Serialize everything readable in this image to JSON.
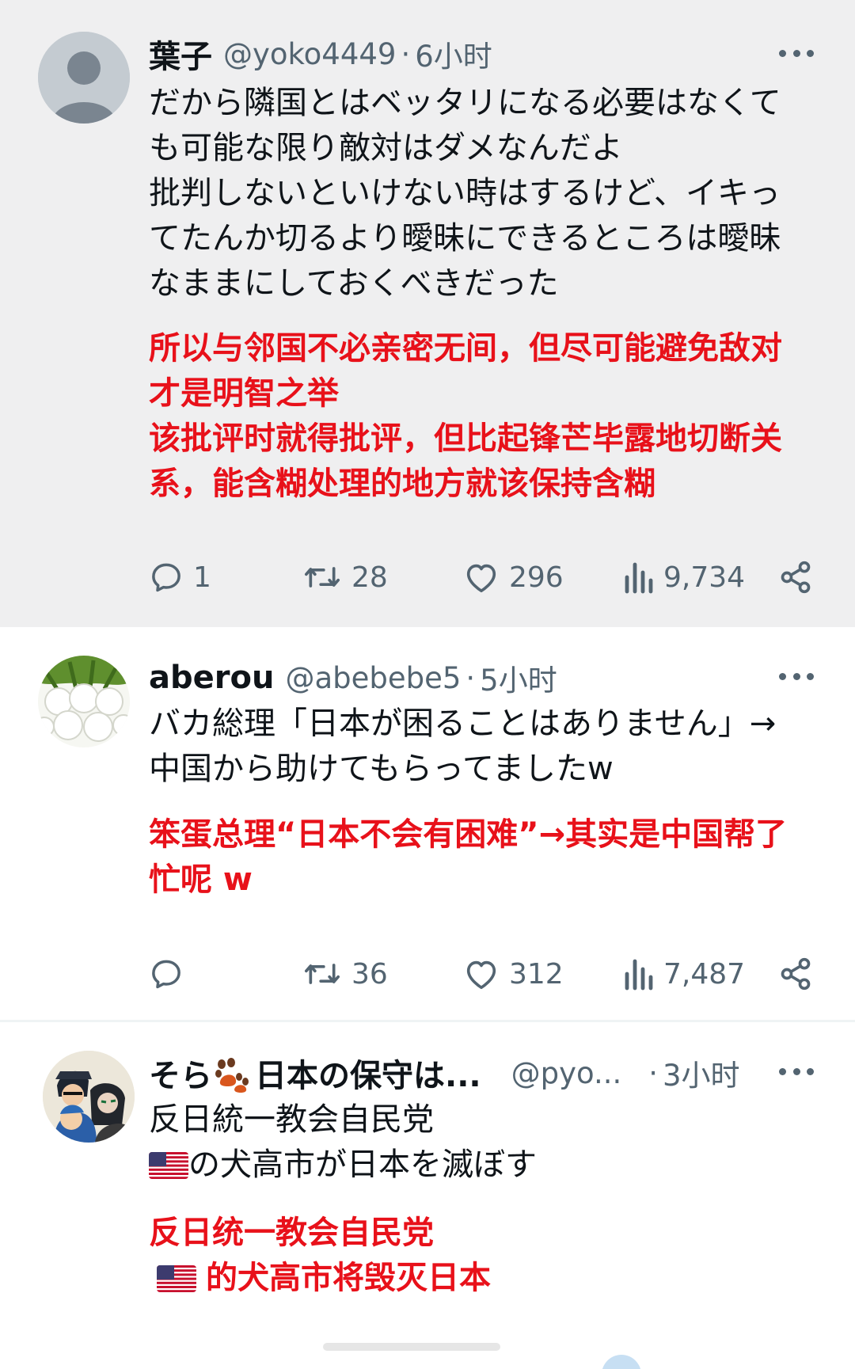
{
  "posts": [
    {
      "name": "葉子",
      "handle": "@yoko4449",
      "separator": "·",
      "time": "6小时",
      "body_jp": [
        "だから隣国とはベッタリになる必要はなくて",
        "も可能な限り敵対はダメなんだよ",
        "批判しないといけない時はするけど、イキっ",
        "てたんか切るより曖昧にできるところは曖昧",
        "なままにしておくべきだった"
      ],
      "body_zh": [
        "所以与邻国不必亲密无间，但尽可能避免敌对",
        "才是明智之举",
        "该批评时就得批评，但比起锋芒毕露地切断关",
        "系，能含糊处理的地方就该保持含糊"
      ],
      "replies": "1",
      "reposts": "28",
      "likes": "296",
      "views": "9,734"
    },
    {
      "name": "aberou",
      "handle": "@abebebe5",
      "separator": "·",
      "time": "5小时",
      "body_jp": [
        "バカ総理「日本が困ることはありません」→",
        "中国から助けてもらってましたw"
      ],
      "body_zh": [
        "笨蛋总理“日本不会有困难”→其实是中国帮了",
        "忙呢 w"
      ],
      "replies": "",
      "reposts": "36",
      "likes": "312",
      "views": "7,487"
    },
    {
      "name_a": "そら",
      "name_b": "日本の保守は...",
      "handle": "@pyo...",
      "separator": "·",
      "time": "3小时",
      "body_jp_1": "反日統一教会自民党",
      "body_jp_2": "の犬高市が日本を滅ぼす",
      "body_zh_1": "反日统一教会自民党",
      "body_zh_2": "的犬高市将毁灭日本"
    }
  ],
  "icons": [
    "reply-icon",
    "repost-icon",
    "like-icon",
    "views-icon",
    "share-icon",
    "more-icon",
    "paw-icon",
    "us-flag-icon"
  ],
  "colors": {
    "highlight_bg": "#efeff0",
    "translation_red": "#e8111a",
    "secondary_text": "#536471",
    "primary_text": "#0f1419"
  }
}
